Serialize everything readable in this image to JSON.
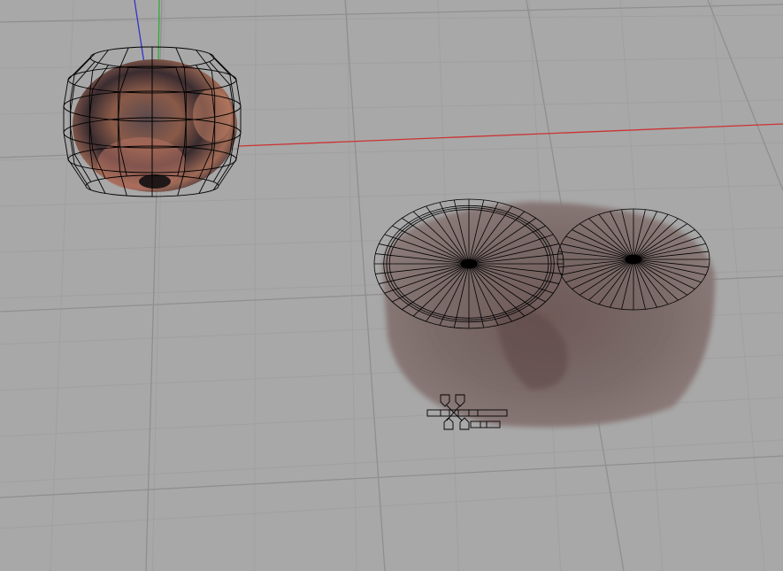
{
  "viewport": {
    "background_color": "#a8a8a8",
    "grid_major_color": "#8f8f8f",
    "grid_minor_color": "#a0a0a0",
    "axis_x_color": "#cc3333",
    "axis_y_color": "#33aa33",
    "axis_z_color": "#3333cc",
    "wire_color": "#000000",
    "objects": [
      {
        "name": "textured-sphere-with-cage",
        "icon": "sphere-mesh"
      },
      {
        "name": "textured-disc-with-two-wire-circles",
        "icon": "disc-mesh"
      },
      {
        "name": "bone-rig-gizmo",
        "icon": "rig-handles"
      }
    ]
  }
}
